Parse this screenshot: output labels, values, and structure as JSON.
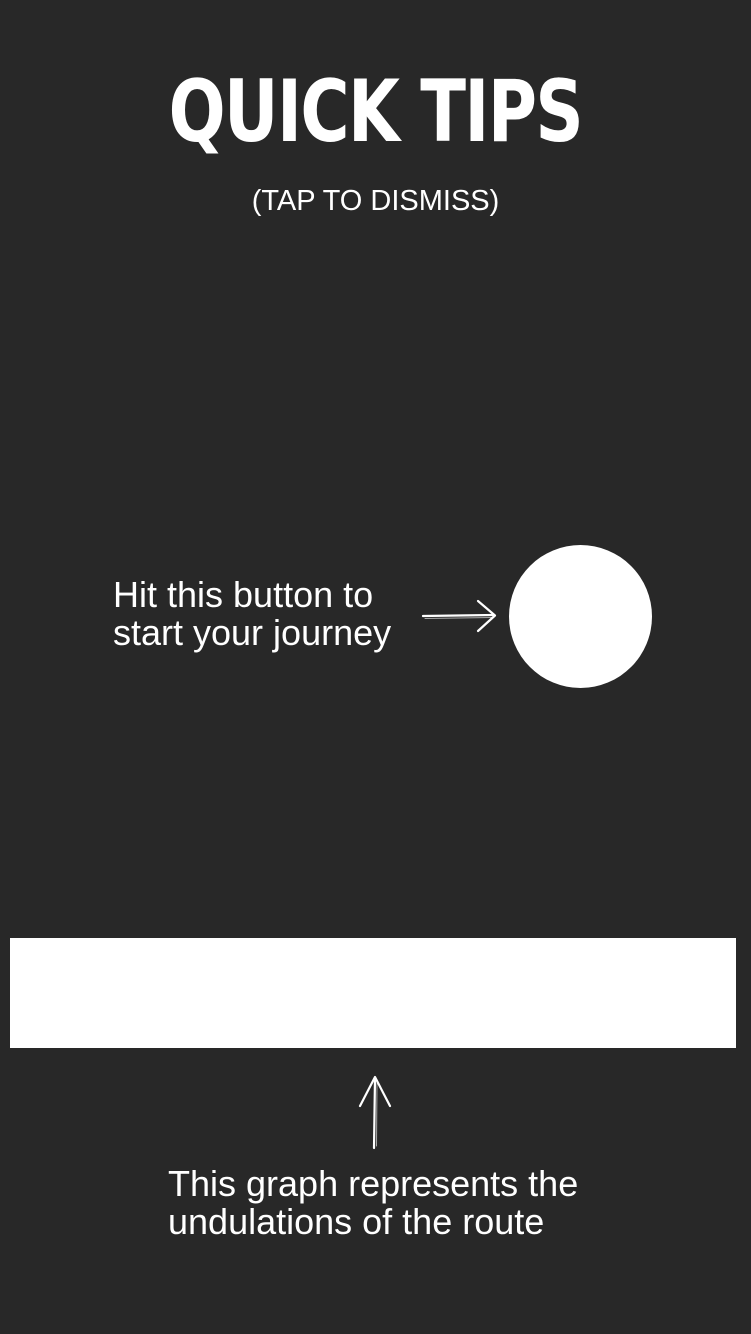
{
  "overlay": {
    "title": "QUICK TIPS",
    "dismiss_hint": "(TAP TO DISMISS)"
  },
  "tips": {
    "start_button": {
      "line1": "Hit this button to",
      "line2": "start your journey",
      "arrow_icon": "arrow-right-icon"
    },
    "graph": {
      "line1": "This graph represents the",
      "line2": "undulations of the route",
      "arrow_icon": "arrow-up-icon"
    }
  },
  "colors": {
    "background": "#282828",
    "foreground": "#ffffff"
  }
}
